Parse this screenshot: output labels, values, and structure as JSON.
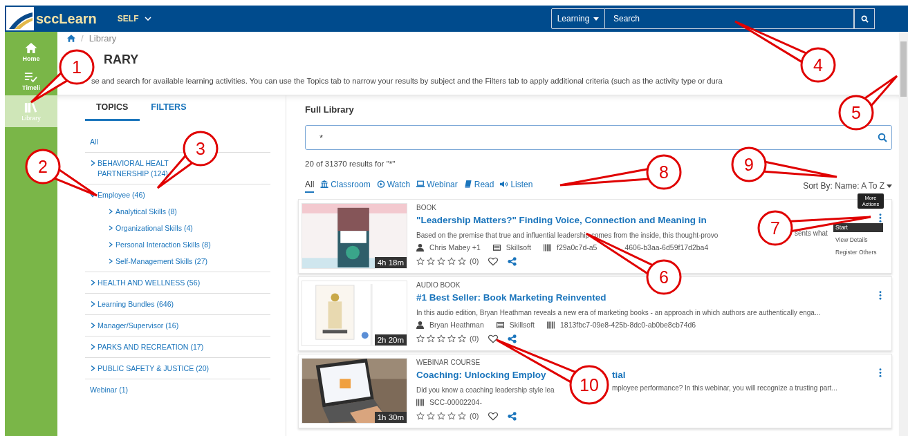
{
  "app": {
    "logo_text": "sccLearn",
    "context_menu": "SELF"
  },
  "search": {
    "scope": "Learning",
    "placeholder": "Search"
  },
  "nav": [
    {
      "label": "Home",
      "kind": "home",
      "selected": false
    },
    {
      "label": "Timeli",
      "kind": "timeline",
      "selected": false
    },
    {
      "label": "Library",
      "kind": "library",
      "selected": true
    }
  ],
  "breadcrumb_separator": "/",
  "breadcrumb": [
    "Library"
  ],
  "page": {
    "title": "RARY",
    "description": "se and search for available learning activities. You can use the Topics tab to narrow your results by subject and the Filters tab to apply additional criteria (such as the activity type or dura"
  },
  "topic_tabs": [
    {
      "label": "TOPICS",
      "selected": true
    },
    {
      "label": "FILTERS",
      "selected": false
    }
  ],
  "topics": [
    {
      "label": "All"
    },
    {
      "label": "BEHAVIORAL HEALT\nPARTNERSHIP (124)",
      "expanded": false
    },
    {
      "label": "Employee (46)",
      "expanded": true,
      "children": [
        {
          "label": "Analytical Skills (8)"
        },
        {
          "label": "Organizational Skills (4)"
        },
        {
          "label": "Personal Interaction Skills (8)"
        },
        {
          "label": "Self-Management Skills (27)"
        }
      ]
    },
    {
      "label": "HEALTH AND WELLNESS (56)",
      "expanded": false
    },
    {
      "label": "Learning Bundles (646)",
      "expanded": false
    },
    {
      "label": "Manager/Supervisor (16)",
      "expanded": false
    },
    {
      "label": "PARKS AND RECREATION (17)",
      "expanded": false
    },
    {
      "label": "PUBLIC SAFETY & JUSTICE (20)",
      "expanded": false
    },
    {
      "label": "Webinar (1)"
    }
  ],
  "results": {
    "title": "Full Library",
    "query": "*",
    "count": "20 of 31370 results for \"*\"",
    "sort": "Sort By: Name: A To Z",
    "types": [
      {
        "label": "All",
        "kind": "all",
        "selected": true
      },
      {
        "label": "Classroom",
        "kind": "classroom",
        "selected": false
      },
      {
        "label": "Watch",
        "kind": "watch",
        "selected": false
      },
      {
        "label": "Webinar",
        "kind": "webinar",
        "selected": false
      },
      {
        "label": "Read",
        "kind": "read",
        "selected": false
      },
      {
        "label": "Listen",
        "kind": "listen",
        "selected": false
      }
    ],
    "items": [
      {
        "type": "BOOK",
        "title": "\"Leadership Matters?\" Finding Voice, Connection and Meaning in",
        "description": "Based on the premise that true and influential leadership comes from the inside, this thought-provo",
        "description_tail": "sents what",
        "author": "Chris Mabey +1",
        "provider": "Skillsoft",
        "code": "f29a0c7d-a5",
        "code_tail": "4606-b3aa-6d59f17d2ba4",
        "duration": "4h 18m",
        "stars": 0,
        "rating_count": "(0)",
        "favorite": false,
        "tooltip": "More Actions",
        "menu": [
          {
            "label": "Start",
            "selected": true
          },
          {
            "label": "View Details",
            "selected": false
          },
          {
            "label": "Register Others",
            "selected": false
          }
        ]
      },
      {
        "type": "AUDIO BOOK",
        "title": "#1 Best Seller: Book Marketing Reinvented",
        "description": "In this audio edition, Bryan Heathman reveals a new era of marketing books - an approach in which authors are authentically enga...",
        "author": "Bryan Heathman",
        "provider": "Skillsoft",
        "code": "1813fbc7-09e8-425b-8dc0-ab0be8cb74d6",
        "duration": "2h 20m",
        "stars": 0,
        "rating_count": "(0)",
        "favorite": false
      },
      {
        "type": "WEBINAR COURSE",
        "title": "Coaching: Unlocking Employ",
        "title_tail": "tial",
        "description": "Did you know a coaching leadership style lea",
        "description_tail": "mployee performance? In this webinar, you will recognize a trusting part...",
        "code": "SCC-00002204-",
        "duration": "1h 30m",
        "stars": 0,
        "rating_count": "(0)",
        "favorite": false
      }
    ]
  },
  "callouts": [
    {
      "number": "1"
    },
    {
      "number": "2"
    },
    {
      "number": "3"
    },
    {
      "number": "4"
    },
    {
      "number": "5"
    },
    {
      "number": "6"
    },
    {
      "number": "7"
    },
    {
      "number": "8"
    },
    {
      "number": "9"
    },
    {
      "number": "10"
    }
  ]
}
